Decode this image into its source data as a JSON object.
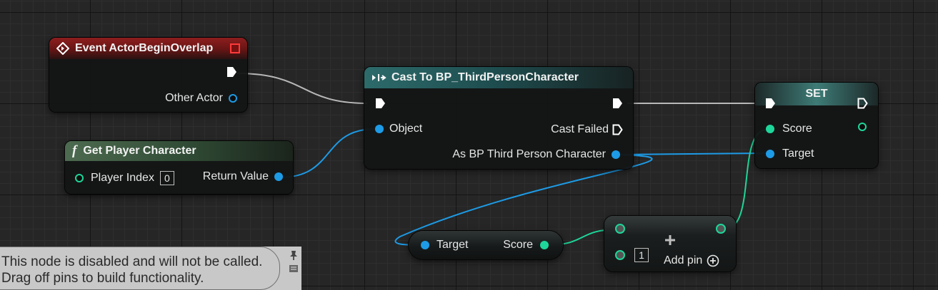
{
  "event_node": {
    "title": "Event ActorBeginOverlap",
    "other_actor": "Other Actor"
  },
  "func_node": {
    "title": "Get Player Character",
    "player_index_label": "Player Index",
    "player_index_value": "0",
    "return_value": "Return Value"
  },
  "cast_node": {
    "title": "Cast To BP_ThirdPersonCharacter",
    "object": "Object",
    "cast_failed": "Cast Failed",
    "as_output": "As BP Third Person Character"
  },
  "set_node": {
    "title": "SET",
    "score": "Score",
    "target": "Target"
  },
  "getter_node": {
    "target": "Target",
    "score": "Score"
  },
  "add_node": {
    "value": "1",
    "add_pin": "Add pin"
  },
  "comment": {
    "line1": "This node is disabled and will not be called.",
    "line2": "Drag off pins to build functionality."
  },
  "colors": {
    "exec": "#ffffff",
    "object": "#1d9be6",
    "integer": "#1ed69a",
    "event_header": "#8e1e1e",
    "func_header": "#4d6b50",
    "cast_header": "#2d6b6b"
  }
}
